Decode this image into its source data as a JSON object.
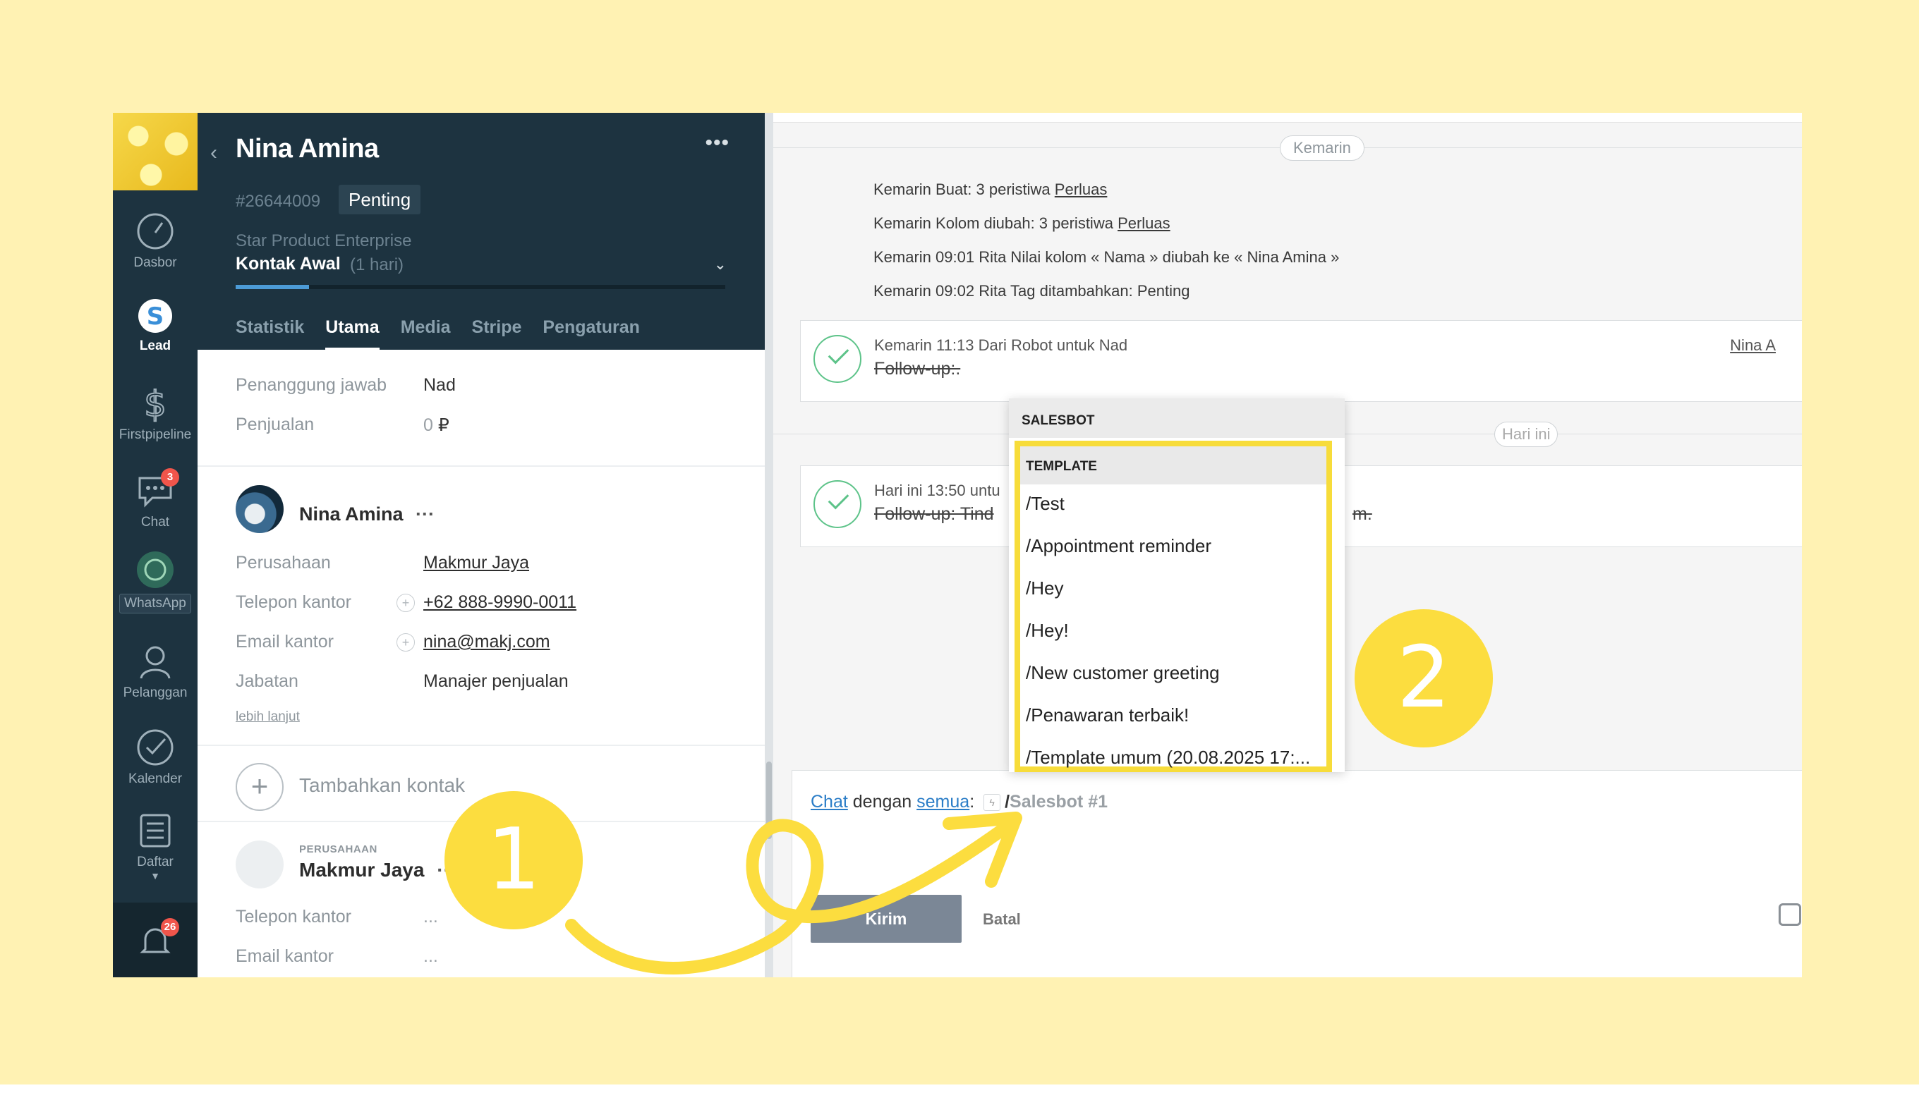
{
  "nav": {
    "items": [
      {
        "label": "Dasbor",
        "icon": "speedometer-icon"
      },
      {
        "label": "Lead",
        "icon": "dollar-icon"
      },
      {
        "label": "Firstpipeline",
        "icon": "dollar-outline-icon"
      },
      {
        "label": "Chat",
        "icon": "chat-bubble-icon",
        "badge": "3"
      },
      {
        "label": "WhatsApp",
        "icon": "whatsapp-icon"
      },
      {
        "label": "Pelanggan",
        "icon": "contacts-icon"
      },
      {
        "label": "Kalender",
        "icon": "checkmark-icon"
      },
      {
        "label": "Daftar",
        "icon": "list-icon"
      }
    ],
    "notifications_badge": "26"
  },
  "lead": {
    "title": "Nina Amina",
    "id": "#26644009",
    "tag": "Penting",
    "pipeline": "Star Product Enterprise",
    "stage": "Kontak Awal",
    "stage_duration": "(1 hari)",
    "stage_progress": 0.15,
    "tabs": [
      "Statistik",
      "Utama",
      "Media",
      "Stripe",
      "Pengaturan"
    ],
    "responsible_label": "Penanggung jawab",
    "responsible_value": "Nad",
    "sale_label": "Penjualan",
    "sale_value": "0",
    "currency": "₽"
  },
  "contact": {
    "name": "Nina Amina",
    "more": "···",
    "fields": [
      {
        "label": "Perusahaan",
        "value": "Makmur Jaya"
      },
      {
        "label": "Telepon kantor",
        "value": "+62 888-9990-0011"
      },
      {
        "label": "Email kantor",
        "value": "nina@makj.com"
      },
      {
        "label": "Jabatan",
        "value": "Manajer penjualan"
      }
    ],
    "more_link": "lebih lanjut",
    "add_contact": "Tambahkan kontak"
  },
  "company": {
    "small_label": "PERUSAHAAN",
    "name": "Makmur Jaya",
    "more": "···",
    "phone_label": "Telepon kantor",
    "phone_value": "...",
    "email_label": "Email kantor",
    "email_value": "..."
  },
  "feed": {
    "day_yesterday": "Kemarin",
    "events": [
      {
        "text": "Kemarin Buat: 3 peristiwa ",
        "link": "Perluas"
      },
      {
        "text": "Kemarin Kolom diubah: 3 peristiwa ",
        "link": "Perluas"
      },
      {
        "text": "Kemarin 09:01 Rita Nilai kolom « Nama » diubah ke « Nina Amina »",
        "link": ""
      },
      {
        "text": "Kemarin 09:02 Rita Tag ditambahkan: Penting",
        "link": ""
      }
    ],
    "card1": {
      "meta": "Kemarin 11:13  Dari Robot untuk Nad",
      "task": "Follow-up:.",
      "user": "Nina A"
    },
    "day_today": "Hari ini",
    "card2": {
      "meta": "Hari ini 13:50  untu",
      "task": "Follow-up: Tind",
      "task_tail": "m."
    }
  },
  "composer": {
    "chat_link": "Chat",
    "with_text": " dengan ",
    "all_link": "semua",
    "colon": ":",
    "slash": "/",
    "placeholder": "Salesbot #1",
    "send": "Kirim",
    "cancel": "Batal"
  },
  "dropdown": {
    "header": "SALESBOT",
    "section": "TEMPLATE",
    "items": [
      "/Test",
      "/Appointment reminder",
      "/Hey",
      "/Hey!",
      "/New customer greeting",
      "/Penawaran terbaik!",
      "/Template umum (20.08.2025 17:..."
    ]
  },
  "callouts": {
    "one": "1",
    "two": "2"
  },
  "colors": {
    "highlight": "#f7dc3a",
    "callout": "#fcdd3f",
    "background": "#fff2b3",
    "nav": "#1d3340"
  }
}
